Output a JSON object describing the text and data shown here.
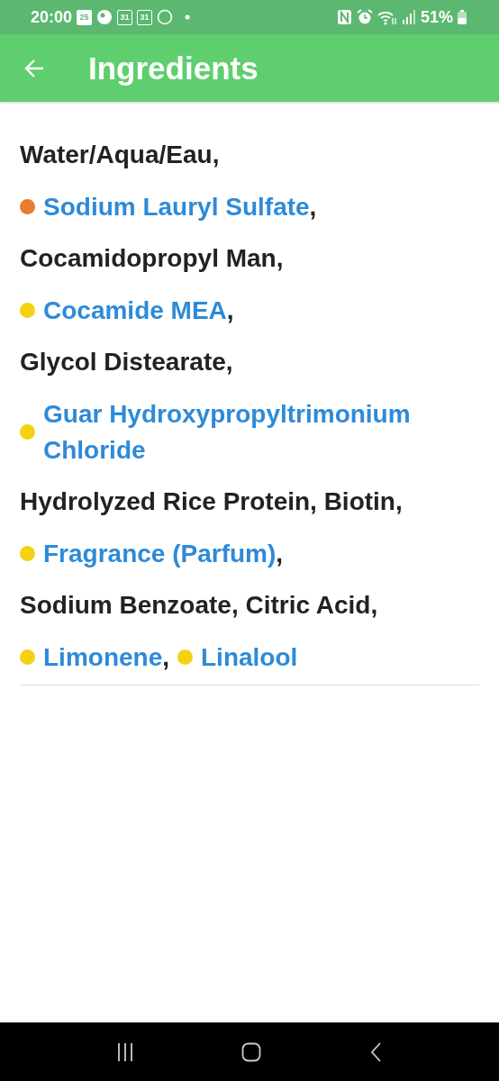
{
  "status_bar": {
    "time": "20:00",
    "notifications": [
      {
        "kind": "calendar_filled",
        "text": "25"
      },
      {
        "kind": "face"
      },
      {
        "kind": "calendar_outline",
        "text": "31"
      },
      {
        "kind": "calendar_outline",
        "text": "31"
      },
      {
        "kind": "circle"
      },
      {
        "kind": "dot"
      }
    ],
    "battery_text": "51%"
  },
  "app_bar": {
    "title": "Ingredients"
  },
  "lines": [
    {
      "items": [
        {
          "kind": "plain",
          "text": "Water/Aqua/Eau,"
        }
      ]
    },
    {
      "items": [
        {
          "kind": "flagged",
          "color": "#e67e2e",
          "text": "Sodium Lauryl Sulfate",
          "separator": ","
        }
      ]
    },
    {
      "items": [
        {
          "kind": "plain",
          "text": "Cocamidopropyl Man,"
        }
      ]
    },
    {
      "items": [
        {
          "kind": "flagged",
          "color": "#f5d211",
          "text": "Cocamide MEA",
          "separator": ","
        }
      ]
    },
    {
      "items": [
        {
          "kind": "plain",
          "text": "Glycol Distearate,"
        }
      ]
    },
    {
      "items": [
        {
          "kind": "flagged",
          "color": "#f5d211",
          "text": "Guar Hydroxypropyltrimonium Chloride"
        }
      ]
    },
    {
      "items": [
        {
          "kind": "plain",
          "text": "Hydrolyzed Rice Protein, Biotin,"
        }
      ]
    },
    {
      "items": [
        {
          "kind": "flagged",
          "color": "#f5d211",
          "text": "Fragrance (Parfum)",
          "separator": ","
        }
      ]
    },
    {
      "items": [
        {
          "kind": "plain",
          "text": "Sodium Benzoate, Citric Acid,"
        }
      ]
    },
    {
      "items": [
        {
          "kind": "flagged",
          "color": "#f5d211",
          "text": "Limonene",
          "separator": ","
        },
        {
          "kind": "flagged",
          "color": "#f5d211",
          "text": "Linalool"
        }
      ]
    }
  ]
}
